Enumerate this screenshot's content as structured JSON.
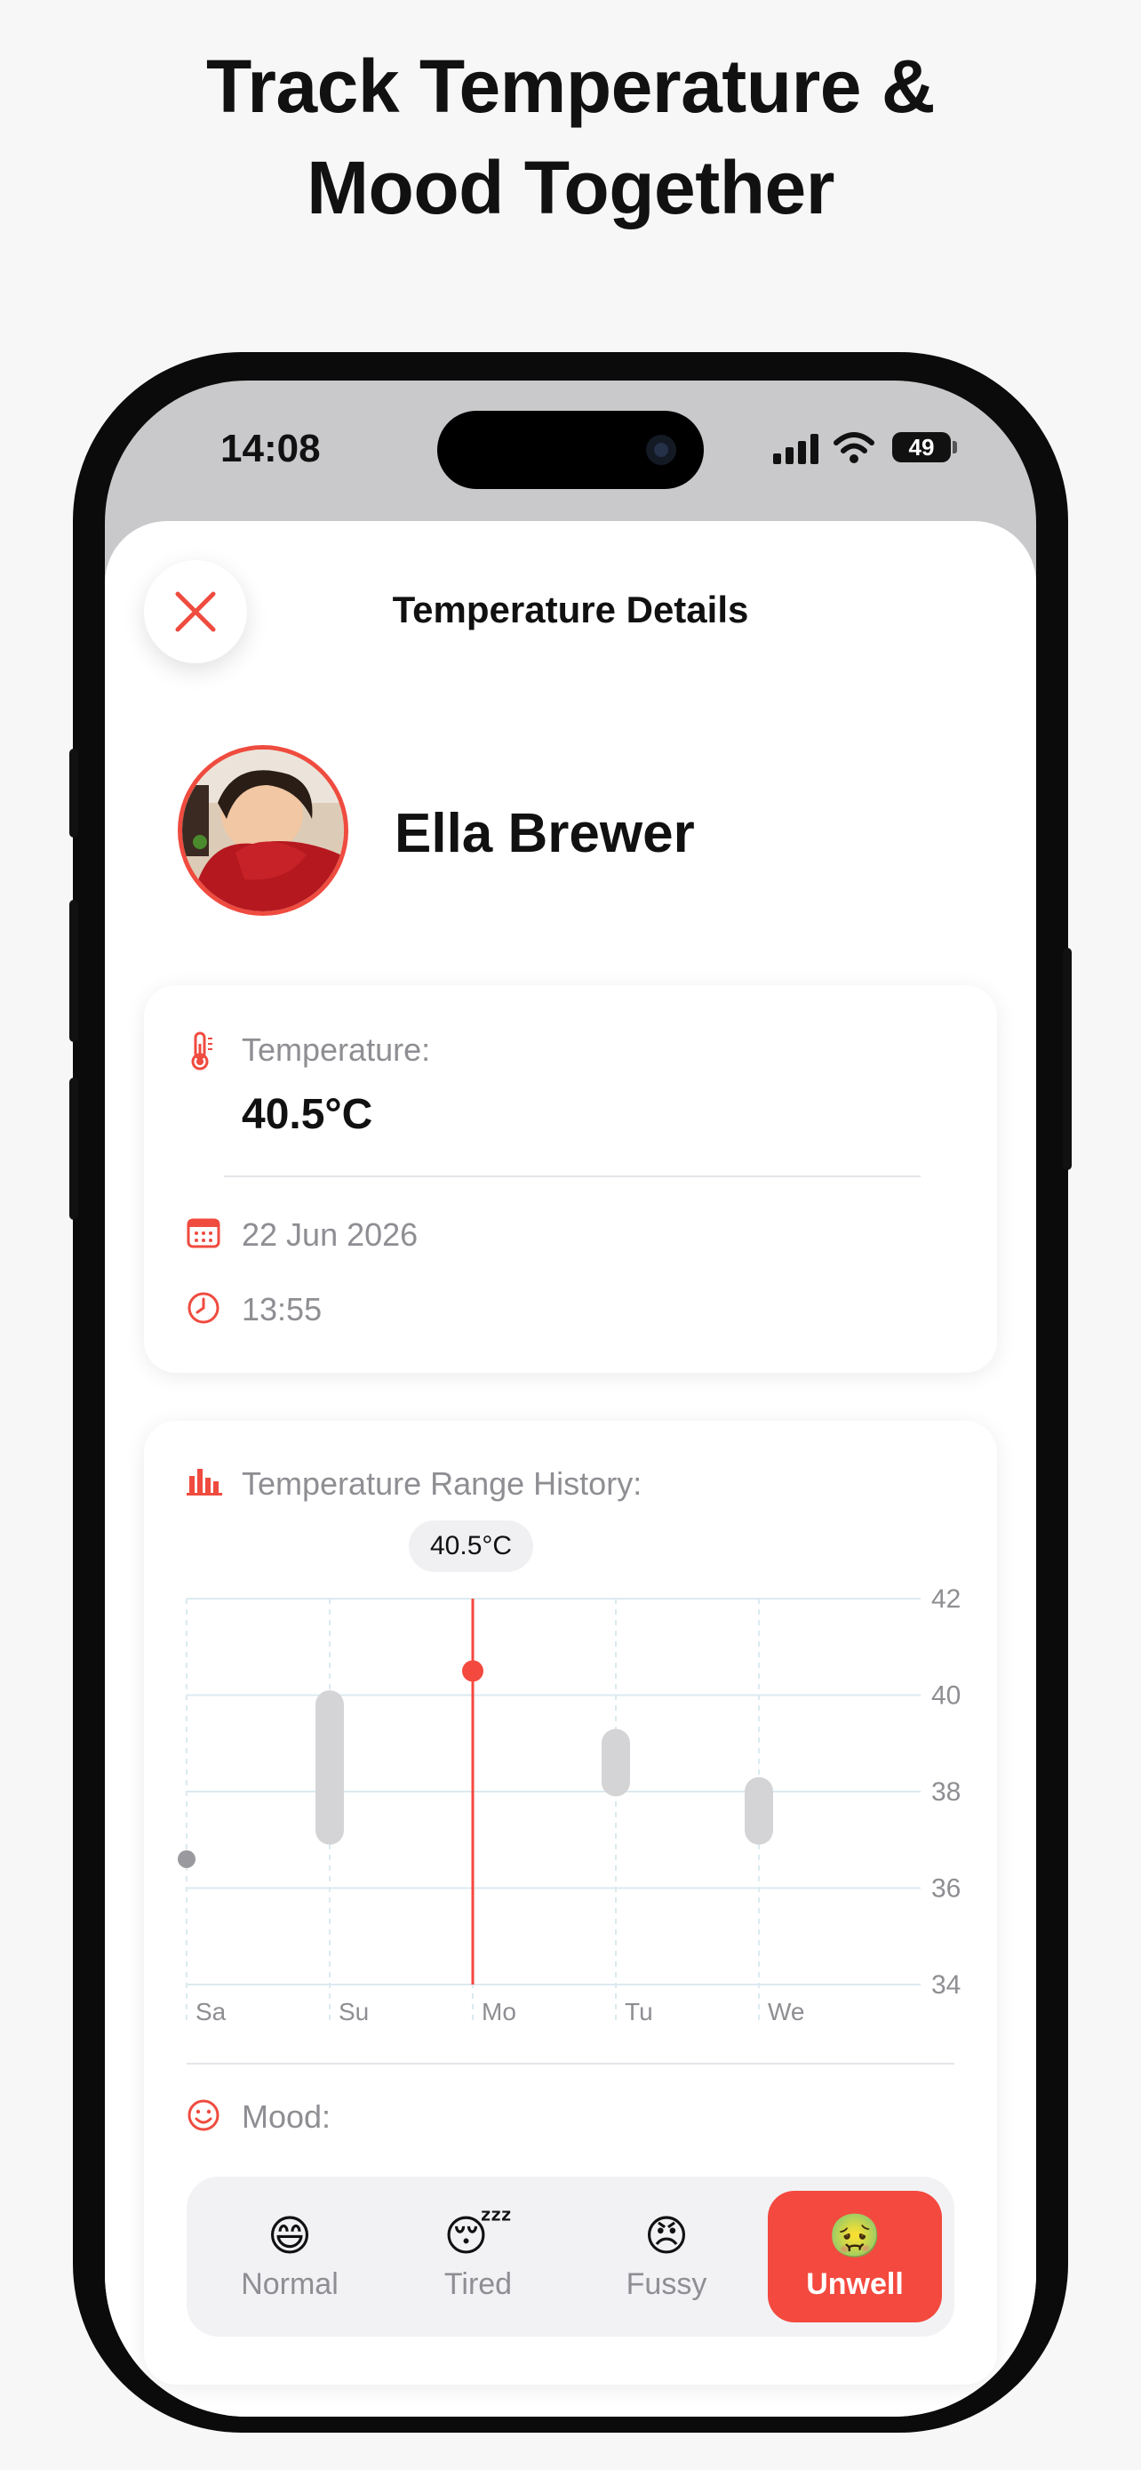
{
  "headline": {
    "line1": "Track Temperature &",
    "line2": "Mood Together"
  },
  "status_bar": {
    "time": "14:08",
    "battery": "49"
  },
  "sheet": {
    "title": "Temperature Details",
    "close_icon": "close-x-icon"
  },
  "child": {
    "name": "Ella Brewer"
  },
  "details": {
    "temperature_label": "Temperature:",
    "temperature_value": "40.5°C",
    "date": "22 Jun 2026",
    "time": "13:55"
  },
  "history": {
    "label": "Temperature Range History:",
    "tooltip": "40.5°C"
  },
  "chart_data": {
    "type": "range-bar",
    "categories": [
      "Sa",
      "Su",
      "Mo",
      "Tu",
      "We"
    ],
    "ranges": [
      {
        "day": "Sa",
        "min": 36.6,
        "max": 36.6
      },
      {
        "day": "Su",
        "min": 36.9,
        "max": 40.1
      },
      {
        "day": "Mo",
        "min": 40.5,
        "max": 40.5
      },
      {
        "day": "Tu",
        "min": 37.9,
        "max": 39.3
      },
      {
        "day": "We",
        "min": 36.9,
        "max": 38.3
      }
    ],
    "selected": "Mo",
    "yticks": [
      42,
      40,
      38,
      36,
      34
    ],
    "ylim": [
      34,
      42
    ],
    "grid": true
  },
  "mood": {
    "label": "Mood:",
    "options": [
      {
        "emoji": "😄",
        "label": "Normal"
      },
      {
        "emoji": "😴",
        "label": "Tired"
      },
      {
        "emoji": "😠",
        "label": "Fussy"
      },
      {
        "emoji": "🤢",
        "label": "Unwell"
      }
    ],
    "selected": "Unwell"
  },
  "colors": {
    "accent": "#f4493e",
    "range_bar": "#d4d4d6",
    "grid": "#dbeaf0"
  }
}
